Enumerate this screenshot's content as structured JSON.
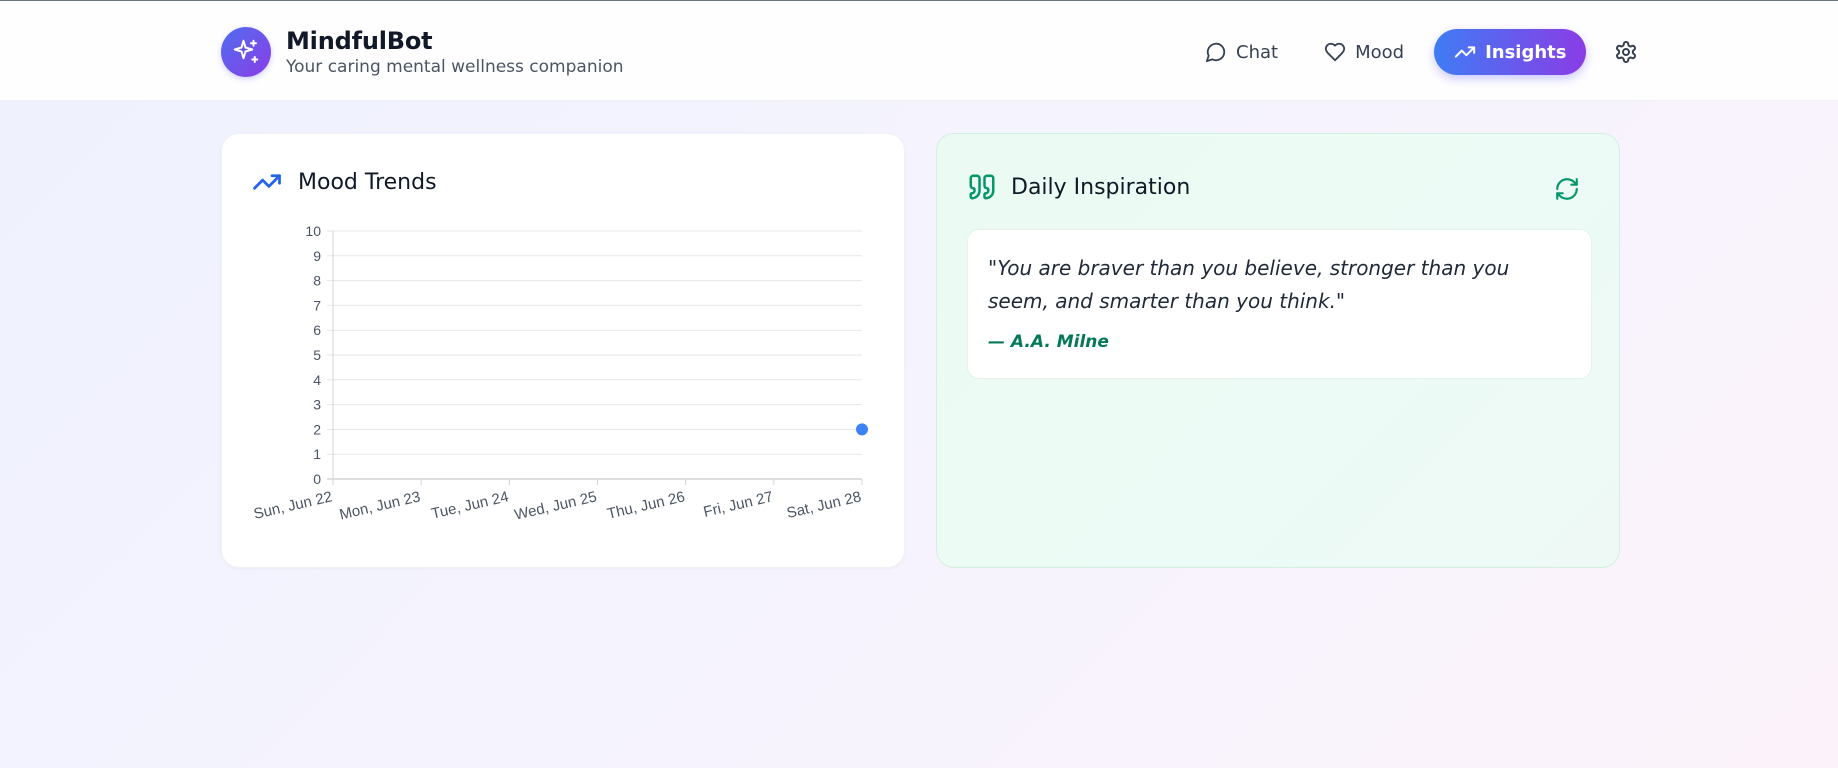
{
  "app": {
    "title": "MindfulBot",
    "subtitle": "Your caring mental wellness companion"
  },
  "nav": {
    "chat_label": "Chat",
    "mood_label": "Mood",
    "insights_label": "Insights",
    "active": "Insights"
  },
  "icons": {
    "logo": "sparkles-icon",
    "chat": "chat-bubble-icon",
    "mood": "heart-icon",
    "insights": "trending-up-icon",
    "settings": "gear-icon",
    "trends": "trending-up-icon",
    "quote": "quote-icon",
    "refresh": "refresh-icon"
  },
  "colors": {
    "accent_blue": "#3f7cf4",
    "accent_purple": "#8b3ce6",
    "point_blue": "#3b82f6",
    "green": "#059669",
    "author_green": "#047857"
  },
  "trends": {
    "title": "Mood Trends"
  },
  "inspiration": {
    "title": "Daily Inspiration",
    "quote": "\"You are braver than you believe, stronger than you seem, and smarter than you think.\"",
    "author": "— A.A. Milne"
  },
  "chart_data": {
    "type": "line",
    "title": "",
    "xlabel": "",
    "ylabel": "",
    "categories": [
      "Sun, Jun 22",
      "Mon, Jun 23",
      "Tue, Jun 24",
      "Wed, Jun 25",
      "Thu, Jun 26",
      "Fri, Jun 27",
      "Sat, Jun 28"
    ],
    "series": [
      {
        "values": [
          null,
          null,
          null,
          null,
          null,
          null,
          2
        ]
      }
    ],
    "ylim": [
      0,
      10
    ],
    "yticks": [
      0,
      1,
      2,
      3,
      4,
      5,
      6,
      7,
      8,
      9,
      10
    ],
    "grid": true,
    "legend": "none"
  }
}
